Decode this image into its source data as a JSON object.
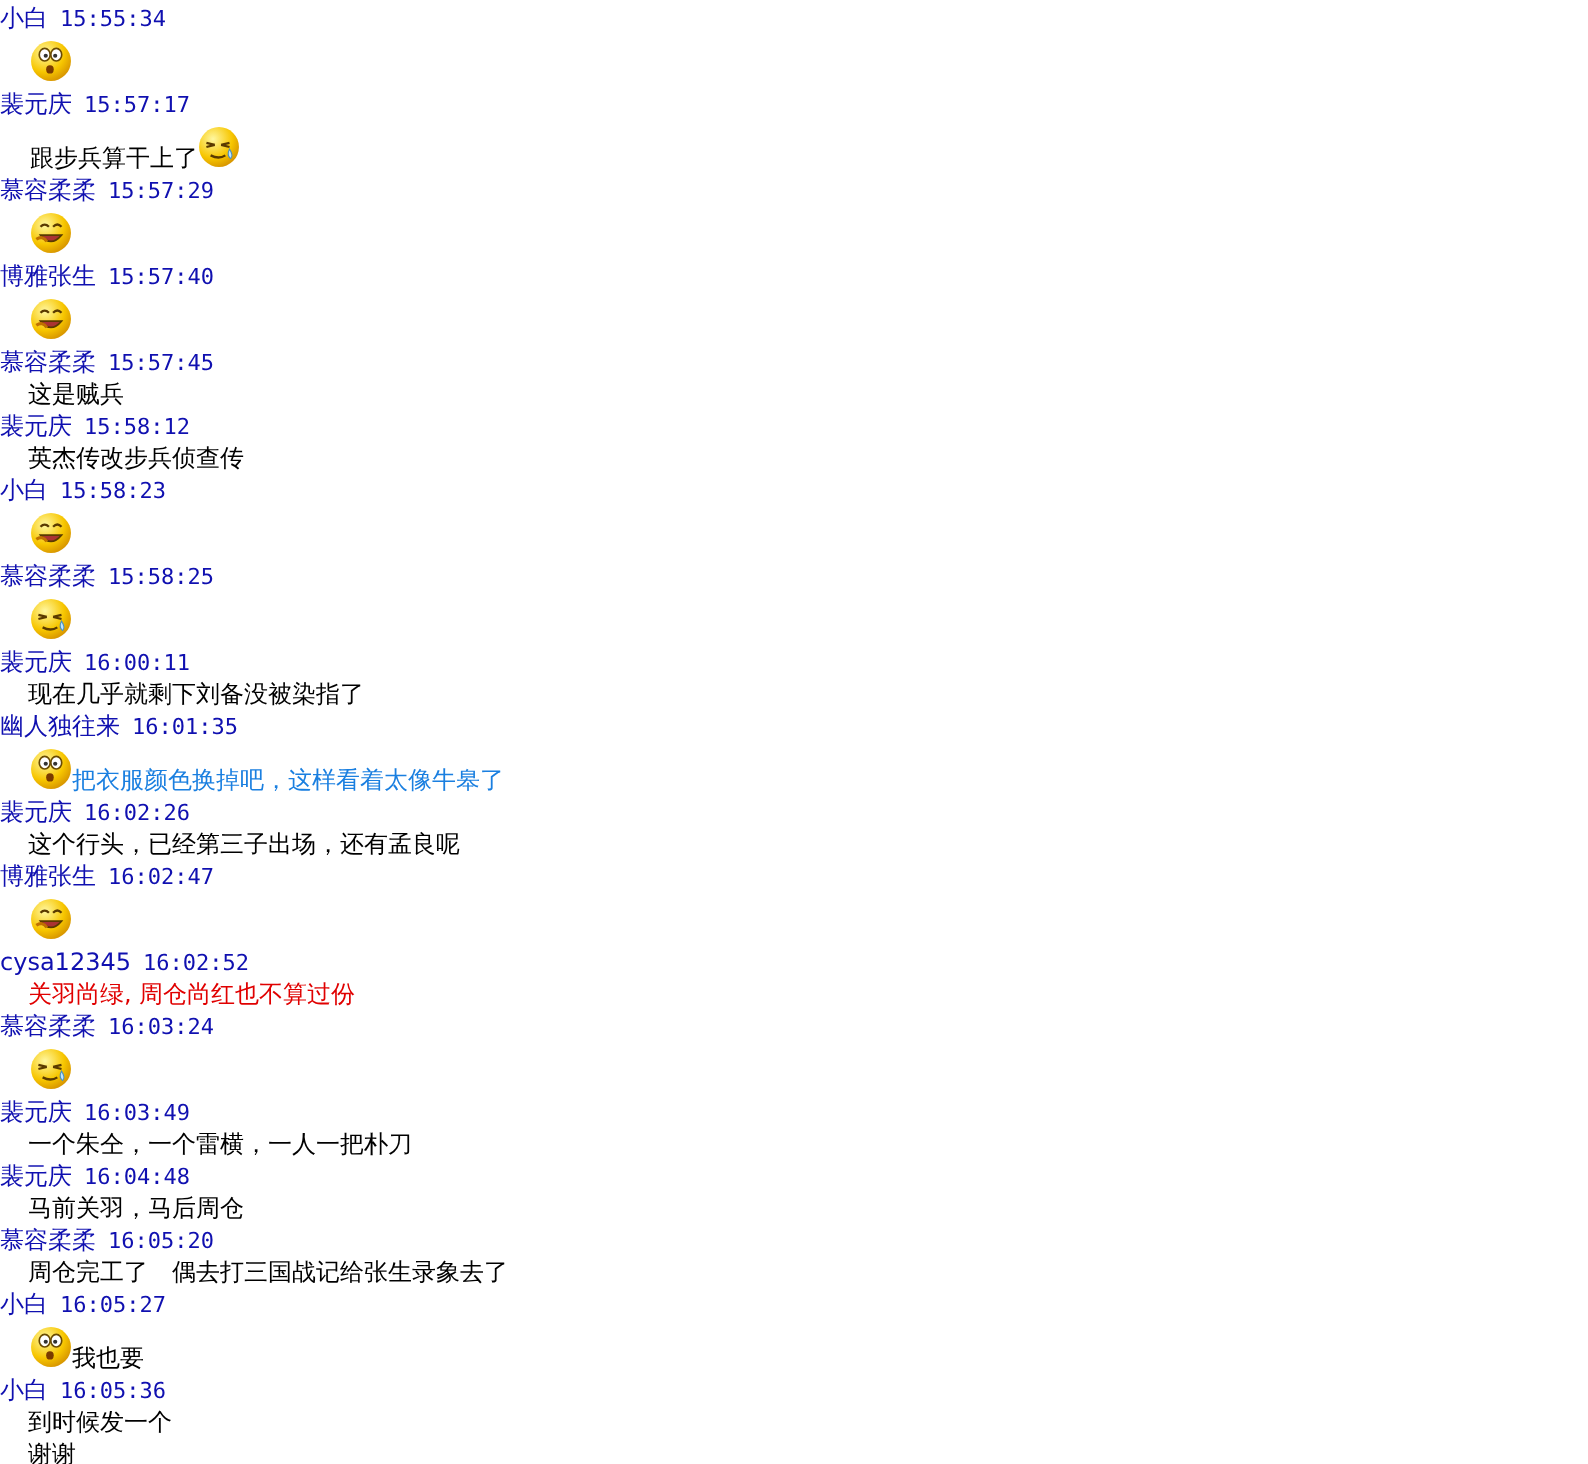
{
  "messages": [
    {
      "sender": "小白",
      "time": "15:55:34",
      "lines": [
        [
          {
            "kind": "surprised"
          }
        ]
      ]
    },
    {
      "sender": "裴元庆",
      "time": "15:57:17",
      "lines": [
        [
          {
            "kind": "text",
            "text": "跟步兵算干上了",
            "color": "#000000"
          },
          {
            "kind": "sweat"
          }
        ]
      ]
    },
    {
      "sender": "慕容柔柔",
      "time": "15:57:29",
      "lines": [
        [
          {
            "kind": "laugh"
          }
        ]
      ]
    },
    {
      "sender": "博雅张生",
      "time": "15:57:40",
      "lines": [
        [
          {
            "kind": "laugh"
          }
        ]
      ]
    },
    {
      "sender": "慕容柔柔",
      "time": "15:57:45",
      "lines": [
        [
          {
            "kind": "text",
            "text": "这是贼兵",
            "color": "#000000"
          }
        ]
      ]
    },
    {
      "sender": "裴元庆",
      "time": "15:58:12",
      "lines": [
        [
          {
            "kind": "text",
            "text": "英杰传改步兵侦查传",
            "color": "#000000"
          }
        ]
      ]
    },
    {
      "sender": "小白",
      "time": "15:58:23",
      "lines": [
        [
          {
            "kind": "laugh"
          }
        ]
      ]
    },
    {
      "sender": "慕容柔柔",
      "time": "15:58:25",
      "lines": [
        [
          {
            "kind": "sweat"
          }
        ]
      ]
    },
    {
      "sender": "裴元庆",
      "time": "16:00:11",
      "lines": [
        [
          {
            "kind": "text",
            "text": "现在几乎就剩下刘备没被染指了",
            "color": "#000000"
          }
        ]
      ]
    },
    {
      "sender": "幽人独往来",
      "time": "16:01:35",
      "lines": [
        [
          {
            "kind": "surprised"
          },
          {
            "kind": "text",
            "text": "把衣服颜色换掉吧，这样看着太像牛皋了",
            "color": "#1a7fe0"
          }
        ]
      ]
    },
    {
      "sender": "裴元庆",
      "time": "16:02:26",
      "lines": [
        [
          {
            "kind": "text",
            "text": "这个行头，已经第三子出场，还有孟良呢",
            "color": "#000000"
          }
        ]
      ]
    },
    {
      "sender": "博雅张生",
      "time": "16:02:47",
      "lines": [
        [
          {
            "kind": "laugh"
          }
        ]
      ]
    },
    {
      "sender": "cysa12345",
      "time": "16:02:52",
      "lines": [
        [
          {
            "kind": "text",
            "text": "关羽尚绿, 周仓尚红也不算过份",
            "color": "#e00000"
          }
        ]
      ]
    },
    {
      "sender": "慕容柔柔",
      "time": "16:03:24",
      "lines": [
        [
          {
            "kind": "sweat"
          }
        ]
      ]
    },
    {
      "sender": "裴元庆",
      "time": "16:03:49",
      "lines": [
        [
          {
            "kind": "text",
            "text": "一个朱仝，一个雷横，一人一把朴刀",
            "color": "#000000"
          }
        ]
      ]
    },
    {
      "sender": "裴元庆",
      "time": "16:04:48",
      "lines": [
        [
          {
            "kind": "text",
            "text": "马前关羽，马后周仓",
            "color": "#000000"
          }
        ]
      ]
    },
    {
      "sender": "慕容柔柔",
      "time": "16:05:20",
      "lines": [
        [
          {
            "kind": "text",
            "text": "周仓完工了　偶去打三国战记给张生录象去了",
            "color": "#000000"
          }
        ]
      ]
    },
    {
      "sender": "小白",
      "time": "16:05:27",
      "lines": [
        [
          {
            "kind": "surprised"
          },
          {
            "kind": "text",
            "text": "我也要",
            "color": "#000000"
          }
        ]
      ]
    },
    {
      "sender": "小白",
      "time": "16:05:36",
      "lines": [
        [
          {
            "kind": "text",
            "text": "到时候发一个",
            "color": "#000000"
          }
        ],
        [
          {
            "kind": "text",
            "text": "谢谢",
            "color": "#000000"
          }
        ]
      ]
    }
  ]
}
